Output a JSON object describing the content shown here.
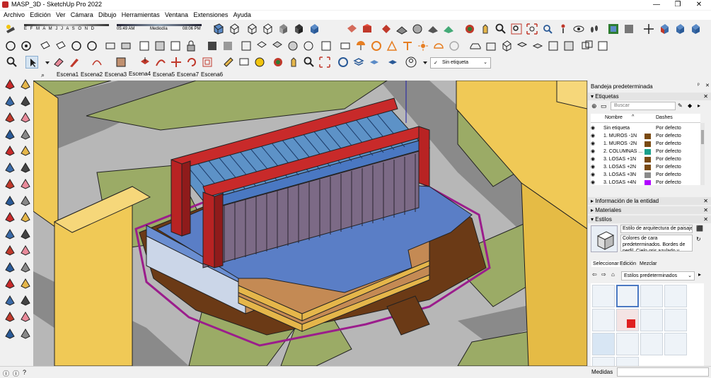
{
  "window": {
    "title": "MASP_3D - SketchUp Pro 2022",
    "minimize": "—",
    "maximize": "❐",
    "close": "✕"
  },
  "menu": [
    "Archivo",
    "Edición",
    "Ver",
    "Cámara",
    "Dibujo",
    "Herramientas",
    "Ventana",
    "Extensiones",
    "Ayuda"
  ],
  "shadows": {
    "months": "E F M A M J J A S O N D",
    "time_start": "05:49 AM",
    "time_mid": "Mediodía",
    "time_end": "08:06 PM"
  },
  "tag_select": {
    "value": "Sin etiqueta"
  },
  "scenes": [
    "Escena1",
    "Escena2",
    "Escena3",
    "Escena4",
    "Escena5",
    "Escena7",
    "Escena6"
  ],
  "tray": {
    "title": "Bandeja predeterminada",
    "etiquetas": {
      "title": "Etiquetas",
      "search_placeholder": "Buscar",
      "col_name": "Nombre",
      "col_dashes": "Dashes",
      "rows": [
        {
          "name": "Sin etiqueta",
          "color": "",
          "dashes": "Por defecto"
        },
        {
          "name": "1. MUROS -1N",
          "color": "#7a4a12",
          "dashes": "Por defecto"
        },
        {
          "name": "1. MUROS -2N",
          "color": "#7a4a12",
          "dashes": "Por defecto"
        },
        {
          "name": "2. COLUMNAS ...",
          "color": "#1aa08c",
          "dashes": "Por defecto"
        },
        {
          "name": "3. LOSAS +1N",
          "color": "#7a4a12",
          "dashes": "Por defecto"
        },
        {
          "name": "3. LOSAS +2N",
          "color": "#7a4a12",
          "dashes": "Por defecto"
        },
        {
          "name": "3. LOSAS +3N",
          "color": "#8a8a8a",
          "dashes": "Por defecto"
        },
        {
          "name": "3. LOSAS +4N",
          "color": "#b000ff",
          "dashes": "Por defecto"
        }
      ]
    },
    "entity_info": "Información de la entidad",
    "materials": "Materiales",
    "styles": {
      "title": "Estilos",
      "name": "Estilo de arquitectura de paisajes",
      "desc": "Colores de cara predeterminados. Bordes de perfil. Cielo gris azulado y fondo verde opaco.",
      "tabs": [
        "Seleccionar",
        "Edición",
        "Mezclar"
      ],
      "library": "Estilos predeterminados"
    }
  },
  "status": {
    "measures_label": "Medidas"
  },
  "icon_names": {
    "left_tools": [
      "select",
      "orbit",
      "paint",
      "eraser",
      "component",
      "tape",
      "line",
      "freehand",
      "rect",
      "rotated-rect",
      "circle",
      "polygon",
      "arc",
      "pie",
      "push-pull",
      "follow-me",
      "move",
      "rotate",
      "scale",
      "offset",
      "dimension",
      "text",
      "axes",
      "section-plane",
      "orbit2",
      "pan",
      "zoom",
      "zoom-window",
      "zoom-extents",
      "walk",
      "position-camera",
      "look-around"
    ]
  }
}
